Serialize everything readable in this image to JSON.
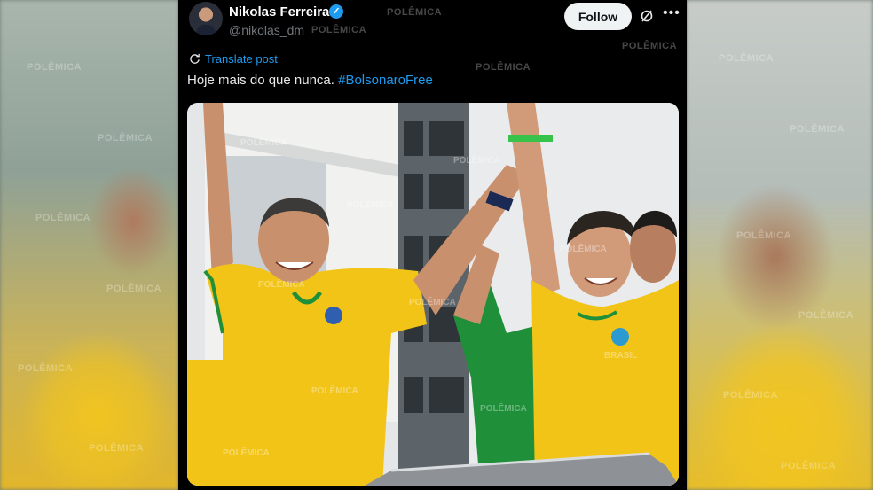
{
  "post": {
    "author": {
      "display_name": "Nikolas Ferreira",
      "handle": "@nikolas_dm",
      "verified": true
    },
    "follow_label": "Follow",
    "translate_label": "Translate post",
    "text": "Hoje mais do que nunca. ",
    "hashtag": "#BolsonaroFree",
    "shirt_badge_text": "BRASIL"
  },
  "watermark": {
    "text": "POLÊMICA"
  },
  "colors": {
    "link": "#1d9bf0",
    "shirt_yellow": "#f2c418",
    "shirt_green": "#1f8f3a",
    "background": "#000000"
  },
  "icons": {
    "verified": "verified-badge-icon",
    "grok": "grok-icon",
    "more": "more-icon",
    "translate": "translate-icon"
  }
}
